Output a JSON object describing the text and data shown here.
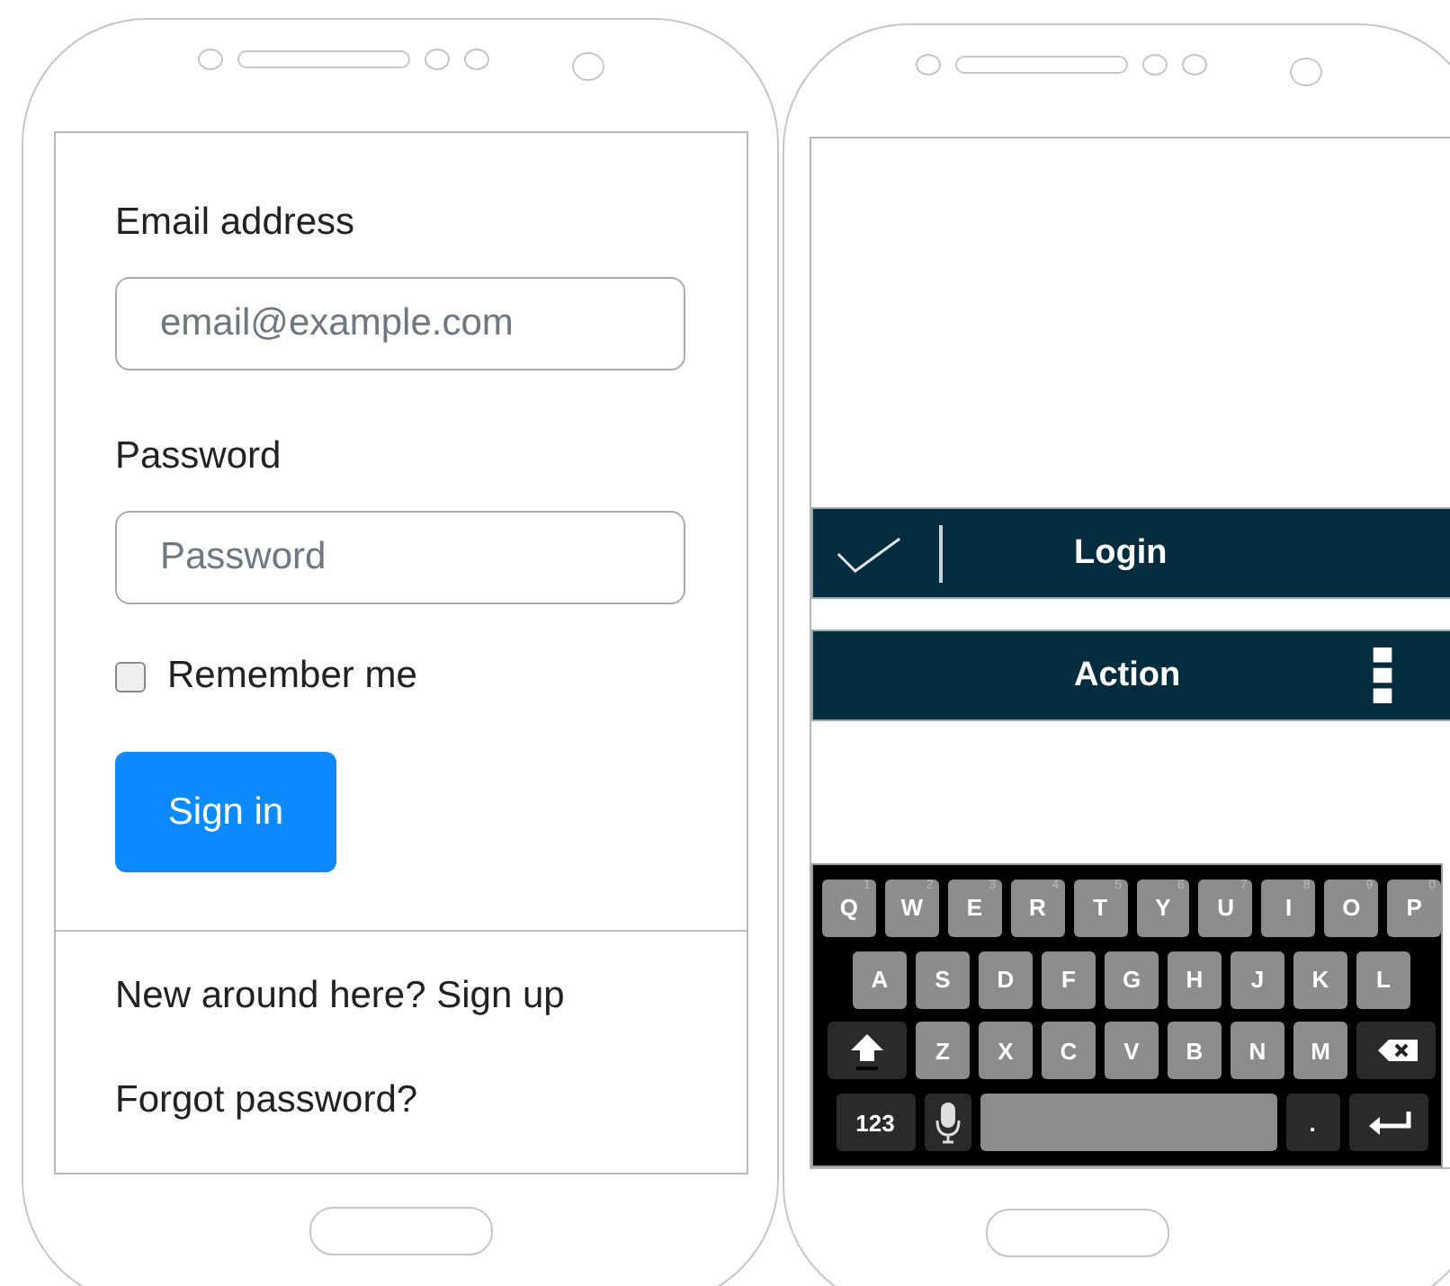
{
  "left_phone": {
    "form": {
      "email": {
        "label": "Email address",
        "placeholder": "email@example.com"
      },
      "password": {
        "label": "Password",
        "placeholder": "Password"
      },
      "remember": {
        "label": "Remember me",
        "checked": false
      },
      "submit": "Sign in"
    },
    "links": [
      "New around here? Sign up",
      "Forgot password?"
    ]
  },
  "right_phone": {
    "login_bar": {
      "title": "Login"
    },
    "action_bar": {
      "title": "Action"
    },
    "keyboard": {
      "rows": [
        [
          {
            "kind": "letter",
            "label": "Q",
            "hint": "1"
          },
          {
            "kind": "letter",
            "label": "W",
            "hint": "2"
          },
          {
            "kind": "letter",
            "label": "E",
            "hint": "3"
          },
          {
            "kind": "letter",
            "label": "R",
            "hint": "4"
          },
          {
            "kind": "letter",
            "label": "T",
            "hint": "5"
          },
          {
            "kind": "letter",
            "label": "Y",
            "hint": "6"
          },
          {
            "kind": "letter",
            "label": "U",
            "hint": "7"
          },
          {
            "kind": "letter",
            "label": "I",
            "hint": "8"
          },
          {
            "kind": "letter",
            "label": "O",
            "hint": "9"
          },
          {
            "kind": "letter",
            "label": "P",
            "hint": "0"
          }
        ],
        [
          {
            "kind": "letter",
            "label": "A"
          },
          {
            "kind": "letter",
            "label": "S"
          },
          {
            "kind": "letter",
            "label": "D"
          },
          {
            "kind": "letter",
            "label": "F"
          },
          {
            "kind": "letter",
            "label": "G"
          },
          {
            "kind": "letter",
            "label": "H"
          },
          {
            "kind": "letter",
            "label": "J"
          },
          {
            "kind": "letter",
            "label": "K"
          },
          {
            "kind": "letter",
            "label": "L"
          }
        ],
        [
          {
            "kind": "shift"
          },
          {
            "kind": "letter",
            "label": "Z"
          },
          {
            "kind": "letter",
            "label": "X"
          },
          {
            "kind": "letter",
            "label": "C"
          },
          {
            "kind": "letter",
            "label": "V"
          },
          {
            "kind": "letter",
            "label": "B"
          },
          {
            "kind": "letter",
            "label": "N"
          },
          {
            "kind": "letter",
            "label": "M"
          },
          {
            "kind": "backspace"
          }
        ],
        [
          {
            "kind": "mode",
            "label": "123"
          },
          {
            "kind": "mic"
          },
          {
            "kind": "space"
          },
          {
            "kind": "mode",
            "label": "."
          },
          {
            "kind": "enter"
          }
        ]
      ]
    }
  }
}
